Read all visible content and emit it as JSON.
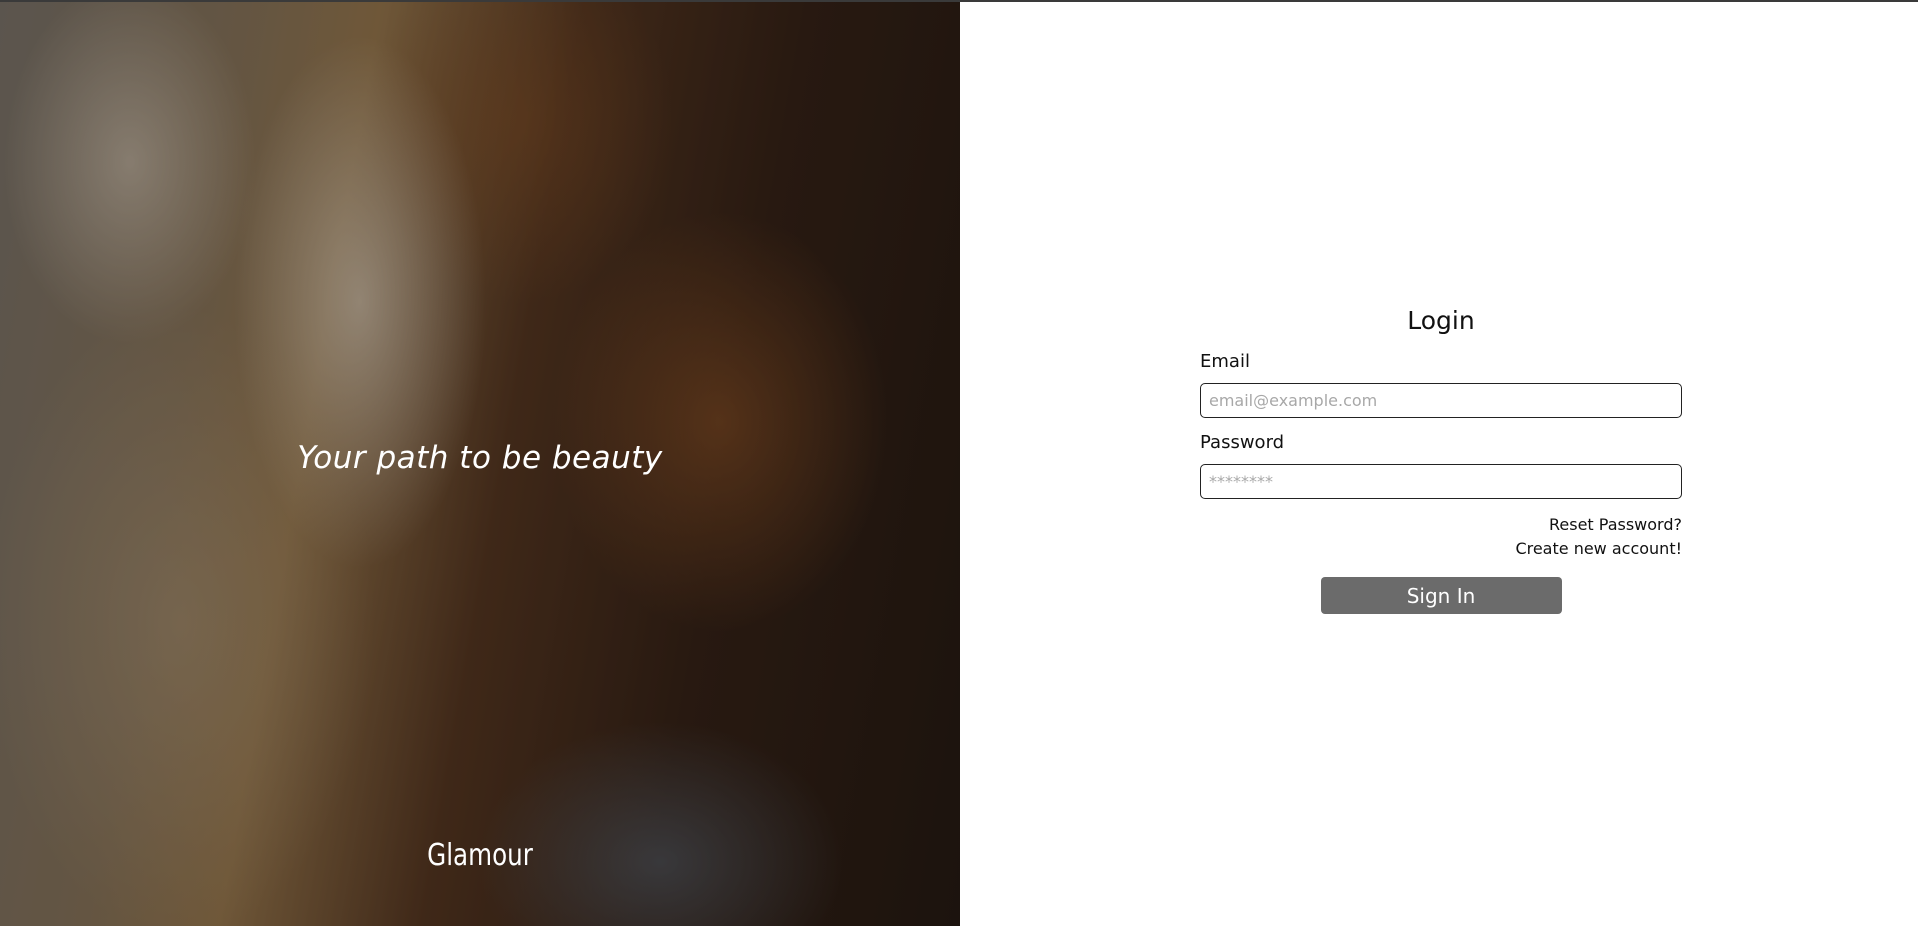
{
  "hero": {
    "tagline": "Your path to be beauty",
    "brand": "Glamour"
  },
  "login": {
    "title": "Login",
    "email_label": "Email",
    "email_placeholder": "email@example.com",
    "email_value": "",
    "password_label": "Password",
    "password_placeholder": "********",
    "password_value": "",
    "reset_link": "Reset Password?",
    "create_link": "Create new account!",
    "submit_label": "Sign In"
  },
  "colors": {
    "button_bg": "#6b6b6b",
    "text": "#111111",
    "placeholder": "#a8a8a8"
  }
}
